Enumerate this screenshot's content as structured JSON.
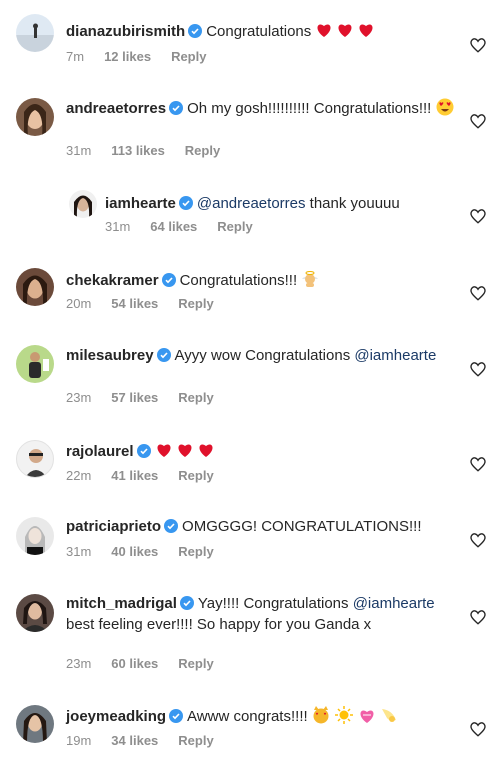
{
  "comments": [
    {
      "user": "dianazubirismith",
      "pre": "Congratulations ",
      "mention": "",
      "post": "",
      "emoji": "hearts3",
      "time": "7m",
      "likes": "12 likes",
      "reply": "Reply"
    },
    {
      "user": "andreaetorres",
      "pre": "Oh my gosh!!!!!!!!!! Congratulations!!! ",
      "mention": "",
      "post": "",
      "emoji": "hearteyes",
      "time": "31m",
      "likes": "113 likes",
      "reply": "Reply"
    },
    {
      "user": "iamhearte",
      "pre": "",
      "mention": "@andreaetorres",
      "post": " thank youuuu",
      "emoji": "",
      "time": "31m",
      "likes": "64 likes",
      "reply": "Reply"
    },
    {
      "user": "chekakramer",
      "pre": "Congratulations!!! ",
      "mention": "",
      "post": "",
      "emoji": "baby",
      "time": "20m",
      "likes": "54 likes",
      "reply": "Reply"
    },
    {
      "user": "milesaubrey",
      "pre": "Ayyy wow Congratulations ",
      "mention": "@iamhearte",
      "post": "",
      "emoji": "",
      "time": "23m",
      "likes": "57 likes",
      "reply": "Reply"
    },
    {
      "user": "rajolaurel",
      "pre": "",
      "mention": "",
      "post": "",
      "emoji": "hearts3",
      "time": "22m",
      "likes": "41 likes",
      "reply": "Reply"
    },
    {
      "user": "patriciaprieto",
      "pre": "OMGGGG! CONGRATULATIONS!!!",
      "mention": "",
      "post": "",
      "emoji": "",
      "time": "31m",
      "likes": "40 likes",
      "reply": "Reply"
    },
    {
      "user": "mitch_madrigal",
      "pre": "Yay!!!! Congratulations ",
      "mention": "@iamhearte",
      "post": " best feeling ever!!!! So happy for you Ganda x",
      "emoji": "",
      "time": "23m",
      "likes": "60 likes",
      "reply": "Reply"
    },
    {
      "user": "joeymeadking",
      "pre": "Awww congrats!!!! ",
      "mention": "",
      "post": "",
      "emoji": "mix",
      "time": "19m",
      "likes": "34 likes",
      "reply": "Reply"
    }
  ],
  "colors": {
    "verified": "#3897f0",
    "heart": "#ed4956",
    "meta": "#8e8e8e",
    "mention": "#1b3a66"
  },
  "icons": {
    "verified": "verified-badge-icon",
    "like": "heart-outline-icon"
  }
}
